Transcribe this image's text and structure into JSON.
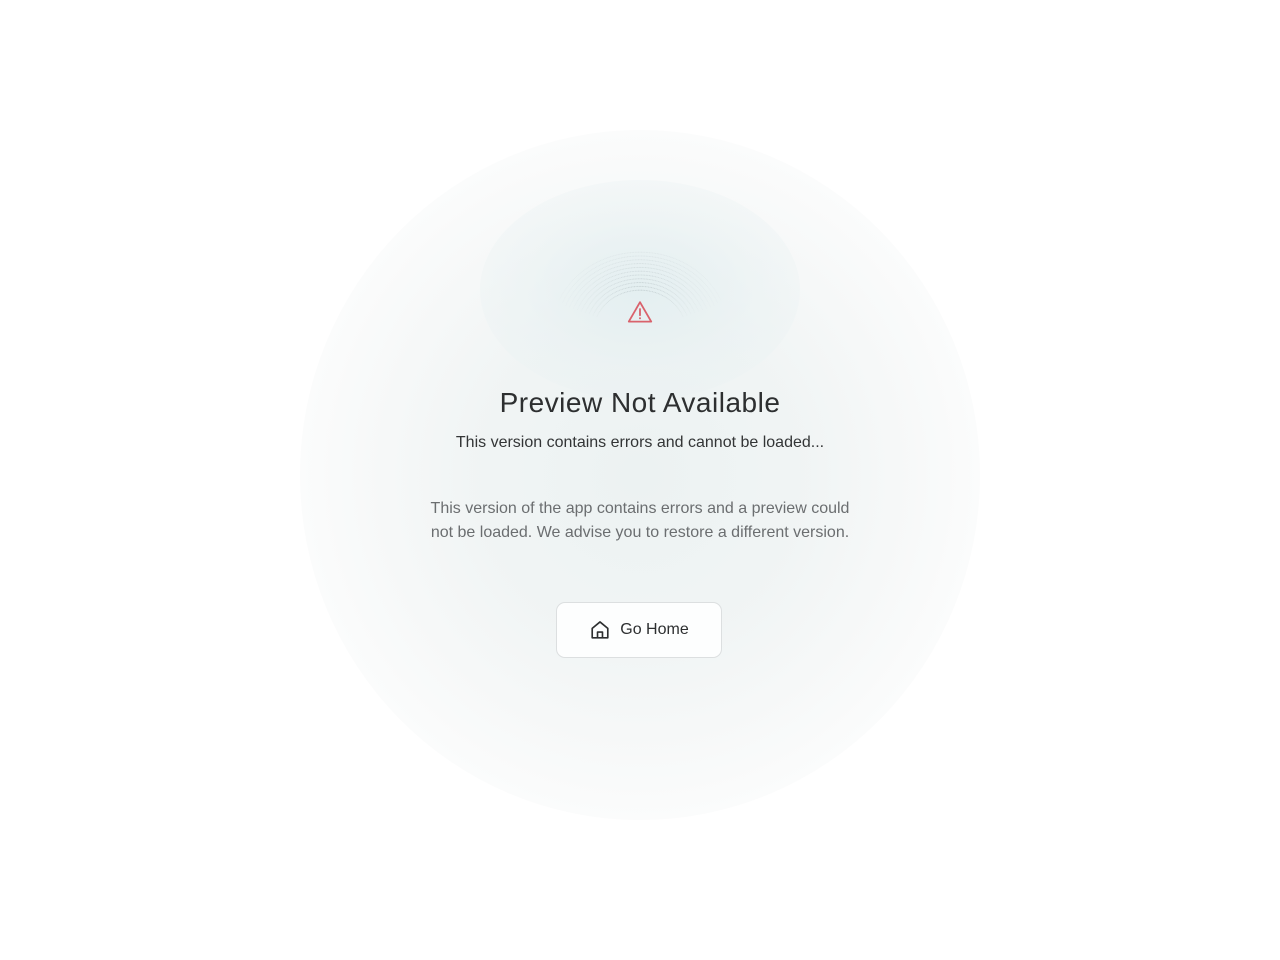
{
  "error": {
    "title": "Preview Not Available",
    "subtitle": "This version contains errors and cannot be loaded...",
    "description": "This version of the app contains errors and a preview could not be loaded. We advise you to restore a different version.",
    "icon": "warning-triangle-icon",
    "icon_color": "#d9626c"
  },
  "actions": {
    "home_label": "Go Home",
    "home_icon": "home-icon"
  },
  "colors": {
    "background": "#ffffff",
    "glow": "#eef3f3",
    "text_primary": "#2d2f30",
    "text_secondary": "#6b6e70",
    "border": "#dcdfe0"
  }
}
